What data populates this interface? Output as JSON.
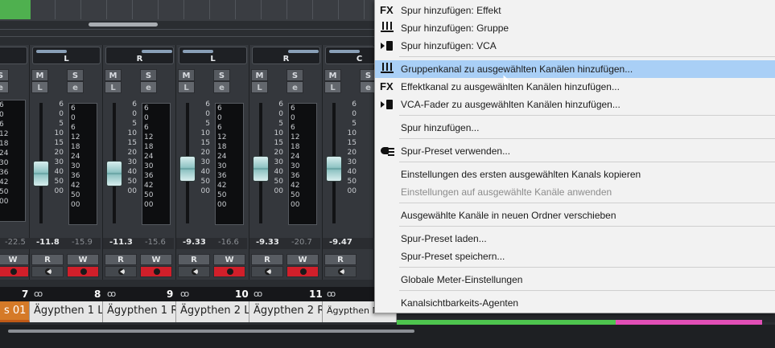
{
  "channels": [
    {
      "pan": "L",
      "meter_peak": "-22.5",
      "fader": "-11.8",
      "peak": "-15.9",
      "number": "8",
      "name": "Ägypthen 1 L"
    },
    {
      "pan": "R",
      "fader": "-11.3",
      "peak": "-15.6",
      "number": "9",
      "name": "Ägypthen 1 R"
    },
    {
      "pan": "L",
      "fader": "-9.33",
      "peak": "-16.6",
      "number": "10",
      "name": "Ägypthen 2 L"
    },
    {
      "pan": "R",
      "fader": "-9.33",
      "peak": "-20.7",
      "number": "11",
      "name": "Ägypthen 2 R"
    },
    {
      "pan": "C",
      "fader": "-9.47",
      "number": "",
      "name": "Ägypthen Ma"
    }
  ],
  "first_channel": {
    "number": "7",
    "name": "s 01",
    "peak": "-22.5"
  },
  "buttons": {
    "m": "M",
    "s": "S",
    "l": "L",
    "e": "e",
    "r": "R",
    "w": "W"
  },
  "fader_scale": [
    "6",
    "0",
    "5",
    "10",
    "15",
    "20",
    "30",
    "40",
    "50",
    "00"
  ],
  "meter_scale": [
    "6",
    "0",
    "6",
    "12",
    "18",
    "24",
    "30",
    "36",
    "42",
    "50",
    "00"
  ],
  "menu": {
    "items": [
      {
        "icon": "FX",
        "label": "Spur hinzufügen: Effekt"
      },
      {
        "icon": "group",
        "label": "Spur hinzufügen: Gruppe"
      },
      {
        "icon": "vca",
        "label": "Spur hinzufügen: VCA"
      },
      {
        "icon": "group",
        "label": "Gruppenkanal zu ausgewählten Kanälen hinzufügen..."
      },
      {
        "icon": "FX",
        "label": "Effektkanal zu ausgewählten Kanälen hinzufügen..."
      },
      {
        "icon": "vca",
        "label": "VCA-Fader zu ausgewählten Kanälen hinzufügen..."
      },
      {
        "label": "Spur hinzufügen..."
      },
      {
        "icon": "preset",
        "label": "Spur-Preset verwenden..."
      },
      {
        "label": "Einstellungen des ersten ausgewählten Kanals kopieren"
      },
      {
        "label": "Einstellungen auf ausgewählte Kanäle anwenden"
      },
      {
        "label": "Ausgewählte Kanäle in neuen Ordner verschieben"
      },
      {
        "label": "Spur-Preset laden..."
      },
      {
        "label": "Spur-Preset speichern..."
      },
      {
        "label": "Globale Meter-Einstellungen"
      },
      {
        "label": "Kanalsichtbarkeits-Agenten"
      }
    ]
  },
  "colors": {
    "highlight": "#a9cff6",
    "record": "#d11f2a",
    "first_channel": "#d57a28",
    "fader_knob": "#8fc3c3"
  }
}
